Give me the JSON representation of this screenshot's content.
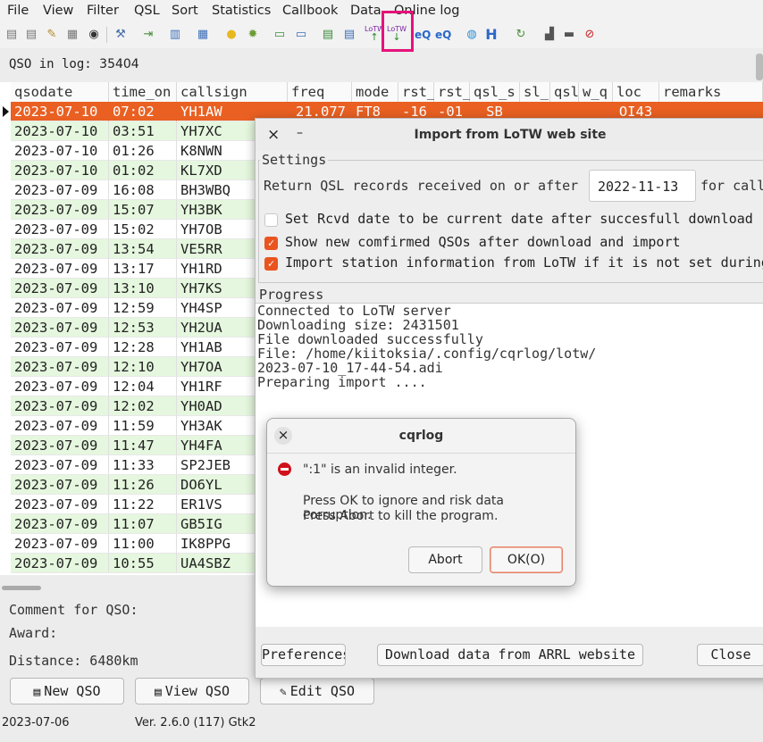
{
  "menu": [
    "File",
    "View",
    "Filter",
    "QSL",
    "Sort",
    "Statistics",
    "Callbook",
    "Data",
    "Online log"
  ],
  "qso_in_log_label": "QSO in log:",
  "qso_in_log_value": "35404",
  "toolbar": {
    "lotw_upload_label": "LoTW",
    "lotw_download_label": "LoTW",
    "eqsl_upload_label": "eQ",
    "eqsl_download_label": "eQ",
    "h_label": "H"
  },
  "columns": [
    "qsodate",
    "time_on",
    "callsign",
    "freq",
    "mode",
    "rst_",
    "rst_",
    "qsl_s",
    "sl_",
    "qsl",
    "w_q",
    "loc",
    "remarks"
  ],
  "rows": [
    {
      "date": "2023-07-10",
      "time": "07:02",
      "call": "YH1AW",
      "freq": "21.077",
      "mode": "FT8",
      "rst_s": "-16",
      "rst_r": "-01",
      "qsl_s": "SB",
      "loc": "OI43"
    },
    {
      "date": "2023-07-10",
      "time": "03:51",
      "call": "YH7XC"
    },
    {
      "date": "2023-07-10",
      "time": "01:26",
      "call": "K8NWN"
    },
    {
      "date": "2023-07-10",
      "time": "01:02",
      "call": "KL7XD"
    },
    {
      "date": "2023-07-09",
      "time": "16:08",
      "call": "BH3WBQ"
    },
    {
      "date": "2023-07-09",
      "time": "15:07",
      "call": "YH3BK"
    },
    {
      "date": "2023-07-09",
      "time": "15:02",
      "call": "YH7OB"
    },
    {
      "date": "2023-07-09",
      "time": "13:54",
      "call": "VE5RR"
    },
    {
      "date": "2023-07-09",
      "time": "13:17",
      "call": "YH1RD"
    },
    {
      "date": "2023-07-09",
      "time": "13:10",
      "call": "YH7KS"
    },
    {
      "date": "2023-07-09",
      "time": "12:59",
      "call": "YH4SP"
    },
    {
      "date": "2023-07-09",
      "time": "12:53",
      "call": "YH2UA"
    },
    {
      "date": "2023-07-09",
      "time": "12:28",
      "call": "YH1AB"
    },
    {
      "date": "2023-07-09",
      "time": "12:10",
      "call": "YH7OA"
    },
    {
      "date": "2023-07-09",
      "time": "12:04",
      "call": "YH1RF"
    },
    {
      "date": "2023-07-09",
      "time": "12:02",
      "call": "YH0AD"
    },
    {
      "date": "2023-07-09",
      "time": "11:59",
      "call": "YH3AK"
    },
    {
      "date": "2023-07-09",
      "time": "11:47",
      "call": "YH4FA"
    },
    {
      "date": "2023-07-09",
      "time": "11:33",
      "call": "SP2JEB"
    },
    {
      "date": "2023-07-09",
      "time": "11:26",
      "call": "DO6YL"
    },
    {
      "date": "2023-07-09",
      "time": "11:22",
      "call": "ER1VS"
    },
    {
      "date": "2023-07-09",
      "time": "11:07",
      "call": "GB5IG"
    },
    {
      "date": "2023-07-09",
      "time": "11:00",
      "call": "IK8PPG"
    },
    {
      "date": "2023-07-09",
      "time": "10:55",
      "call": "UA4SBZ"
    }
  ],
  "info": {
    "comment_label": "Comment for QSO:",
    "award_label": "Award:",
    "distance_label": "Distance: 6480km"
  },
  "buttons": {
    "new_qso": "New QSO",
    "view_qso": "View QSO",
    "edit_qso": "Edit QSO"
  },
  "status": {
    "date": "2023-07-06",
    "version": "Ver. 2.6.0 (117) Gtk2"
  },
  "lotw_dialog": {
    "title": "Import from LoTW web site",
    "close_glyph": "×",
    "minimize_glyph": "–",
    "settings_legend": "Settings",
    "return_label": "Return QSL records received on or after",
    "date_value": "2022-11-13",
    "for_call_label": "for call",
    "opt1": "Set Rcvd date to be current date after succesfull download",
    "opt1_checked": false,
    "opt2": "Show new comfirmed QSOs after download and import",
    "opt2_checked": true,
    "opt3": "Import station information from LoTW if it is not set during",
    "opt3_checked": true,
    "progress_legend": "Progress",
    "progress_lines": [
      "Connected to LoTW server",
      "Downloading size: 2431501",
      "File downloaded successfully",
      "File: /home/kiitoksia/.config/cqrlog/lotw/",
      "2023-07-10_17-44-54.adi",
      "Preparing import ...."
    ],
    "preferences_btn": "Preferences",
    "download_btn": "Download data from ARRL website",
    "close_btn": "Close"
  },
  "error_dialog": {
    "title": "cqrlog",
    "close_glyph": "×",
    "message": "\":1\" is an invalid integer.",
    "detail1": "Press OK to ignore and risk data corruption.",
    "detail2": "Press Abort to kill the program.",
    "abort_btn": "Abort",
    "ok_btn": "OK(O)"
  },
  "colors": {
    "selected_row": "#e96022",
    "alt_row": "#e5f7de",
    "highlight_box": "#e6127a",
    "checkbox_on": "#e95420",
    "error_icon": "#d0101b"
  }
}
